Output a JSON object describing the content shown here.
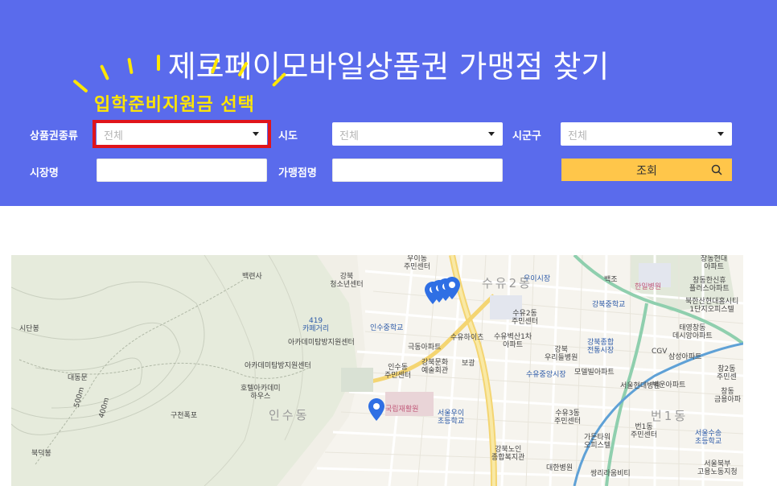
{
  "header": {
    "title": "제로페이모바일상품권 가맹점 찾기",
    "callout": "입학준비지원금 선택",
    "colors": {
      "background": "#5a6bec",
      "callout": "#ffe600",
      "highlight_box": "#e0141b",
      "search_button": "#ffc64a"
    }
  },
  "filters": {
    "voucher_type": {
      "label": "상품권종류",
      "value": "전체"
    },
    "sido": {
      "label": "시도",
      "value": "전체"
    },
    "sigungu": {
      "label": "시군구",
      "value": "전체"
    },
    "market": {
      "label": "시장명",
      "value": ""
    },
    "store": {
      "label": "가맹점명",
      "value": ""
    },
    "search_button": {
      "label": "조회",
      "icon": "search-icon"
    }
  },
  "map": {
    "labels": [
      {
        "text": "우이동\n주민센터",
        "kind": "normal"
      },
      {
        "text": "백련사",
        "kind": "normal"
      },
      {
        "text": "강북\n청소년센터",
        "kind": "normal"
      },
      {
        "text": "우이시장",
        "kind": "blue"
      },
      {
        "text": "백조",
        "kind": "normal"
      },
      {
        "text": "한일병원",
        "kind": "pink"
      },
      {
        "text": "창동현대\n아파트",
        "kind": "normal"
      },
      {
        "text": "창동한신휴\n플러스아파트",
        "kind": "normal"
      },
      {
        "text": "수유2동",
        "kind": "gray"
      },
      {
        "text": "수유2동\n주민센터",
        "kind": "normal"
      },
      {
        "text": "강북중학교",
        "kind": "blue"
      },
      {
        "text": "북한산현대홈시티\n1단지오피스텔",
        "kind": "normal"
      },
      {
        "text": "419\n카페거리",
        "kind": "blue"
      },
      {
        "text": "인수중학교",
        "kind": "blue"
      },
      {
        "text": "수유벽산1차\n아파트",
        "kind": "normal"
      },
      {
        "text": "태영창동\n데시앙아파트",
        "kind": "normal"
      },
      {
        "text": "시단봉",
        "kind": "normal"
      },
      {
        "text": "아카데미탐방지원센터",
        "kind": "normal"
      },
      {
        "text": "수유하이츠",
        "kind": "normal"
      },
      {
        "text": "극동아파트",
        "kind": "normal"
      },
      {
        "text": "강북종합\n전통시장",
        "kind": "blue"
      },
      {
        "text": "CGV",
        "kind": "normal"
      },
      {
        "text": "강북\n우리들병원",
        "kind": "normal"
      },
      {
        "text": "삼성아파트",
        "kind": "normal"
      },
      {
        "text": "인수동\n주민센터",
        "kind": "normal"
      },
      {
        "text": "강북문화\n예술회관",
        "kind": "normal"
      },
      {
        "text": "보광",
        "kind": "normal"
      },
      {
        "text": "수유중앙시장",
        "kind": "blue"
      },
      {
        "text": "모델빌아파트",
        "kind": "normal"
      },
      {
        "text": "창2동\n주민센",
        "kind": "normal"
      },
      {
        "text": "아카데미탐방지원센터",
        "kind": "normal"
      },
      {
        "text": "대동문",
        "kind": "normal"
      },
      {
        "text": "호텔아카데미\n하우스",
        "kind": "normal"
      },
      {
        "text": "서울현대병원",
        "kind": "normal"
      },
      {
        "text": "벽운아파트",
        "kind": "normal"
      },
      {
        "text": "창동\n금용아파",
        "kind": "normal"
      },
      {
        "text": "구천폭포",
        "kind": "normal"
      },
      {
        "text": "국립재활원",
        "kind": "pink"
      },
      {
        "text": "서울우이\n초등학교",
        "kind": "blue"
      },
      {
        "text": "수유3동\n주민센터",
        "kind": "normal"
      },
      {
        "text": "번1동\n주민센터",
        "kind": "normal"
      },
      {
        "text": "번1동",
        "kind": "gray"
      },
      {
        "text": "인수동",
        "kind": "gray"
      },
      {
        "text": "서울수송\n초등학교",
        "kind": "blue"
      },
      {
        "text": "가든타워\n오피스텔",
        "kind": "normal"
      },
      {
        "text": "강북노인\n종합복지관",
        "kind": "normal"
      },
      {
        "text": "북덕봉",
        "kind": "normal"
      },
      {
        "text": "대한병원",
        "kind": "normal"
      },
      {
        "text": "쌍리라움비티",
        "kind": "normal"
      },
      {
        "text": "서울북부\n고용노동지청",
        "kind": "normal"
      },
      {
        "text": "500m",
        "kind": "normal"
      },
      {
        "text": "400m",
        "kind": "normal"
      }
    ],
    "markers": [
      "location-pin",
      "location-pin",
      "location-pin",
      "location-pin",
      "location-pin"
    ]
  }
}
